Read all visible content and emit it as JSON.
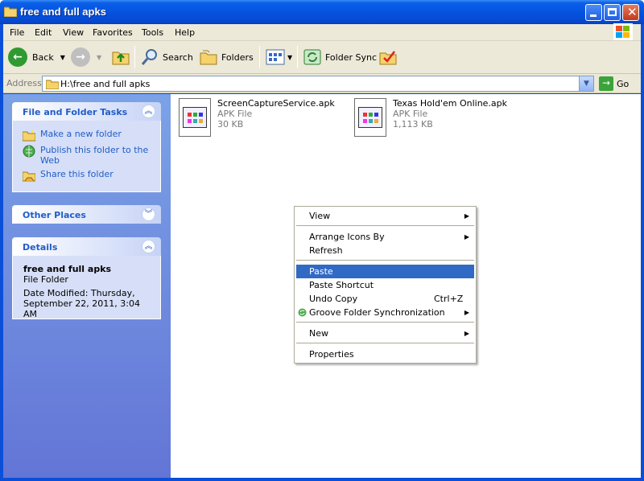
{
  "window": {
    "title": "free and full apks"
  },
  "menubar": {
    "items": [
      "File",
      "Edit",
      "View",
      "Favorites",
      "Tools",
      "Help"
    ]
  },
  "toolbar": {
    "back": "Back",
    "search": "Search",
    "folders": "Folders",
    "folder_sync": "Folder Sync"
  },
  "address": {
    "label": "Address",
    "value": "H:\\free and full apks",
    "go": "Go"
  },
  "taskpane": {
    "file_folder_tasks": {
      "title": "File and Folder Tasks",
      "items": [
        "Make a new folder",
        "Publish this folder to the Web",
        "Share this folder"
      ]
    },
    "other_places": {
      "title": "Other Places"
    },
    "details": {
      "title": "Details",
      "name": "free and full apks",
      "type": "File Folder",
      "modified": "Date Modified: Thursday, September 22, 2011, 3:04 AM"
    }
  },
  "files": [
    {
      "name": "ScreenCaptureService.apk",
      "type": "APK File",
      "size": "30 KB"
    },
    {
      "name": "Texas Hold'em Online.apk",
      "type": "APK File",
      "size": "1,113 KB"
    }
  ],
  "context_menu": {
    "view": "View",
    "arrange": "Arrange Icons By",
    "refresh": "Refresh",
    "paste": "Paste",
    "paste_shortcut": "Paste Shortcut",
    "undo_copy": "Undo Copy",
    "undo_shortcut": "Ctrl+Z",
    "groove": "Groove Folder Synchronization",
    "new": "New",
    "properties": "Properties",
    "selected": "Paste"
  },
  "colors": {
    "titlebar": "#0553e0",
    "taskpane": "#6f8ce0",
    "selection": "#316ac5",
    "link": "#215dc6"
  }
}
